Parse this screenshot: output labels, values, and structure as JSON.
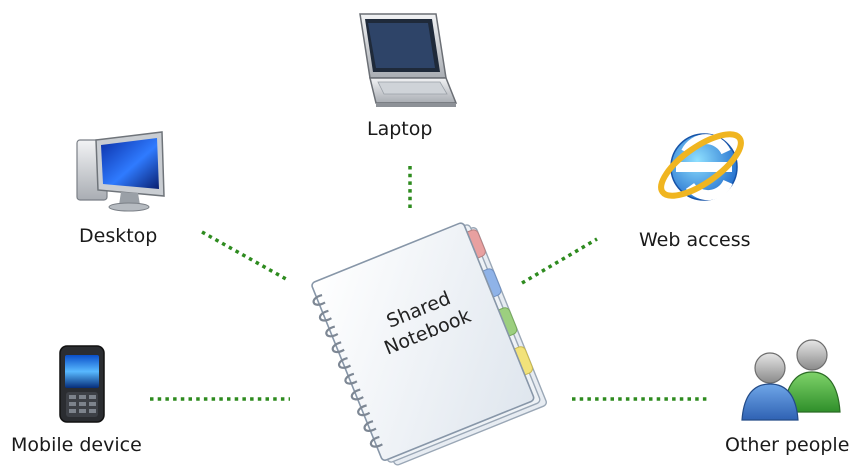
{
  "diagram": {
    "center": {
      "label_line1": "Shared",
      "label_line2": "Notebook"
    },
    "nodes": {
      "laptop": {
        "label": "Laptop",
        "icon": "laptop-icon"
      },
      "desktop": {
        "label": "Desktop",
        "icon": "desktop-monitor-icon"
      },
      "web": {
        "label": "Web access",
        "icon": "internet-explorer-icon"
      },
      "mobile": {
        "label": "Mobile device",
        "icon": "mobile-phone-icon"
      },
      "people": {
        "label": "Other people",
        "icon": "users-group-icon"
      }
    },
    "connector_color": "#2e8b1f",
    "tab_colors": [
      "#e8a0a0",
      "#8fb3e8",
      "#9ccf7f",
      "#f2e27a"
    ]
  }
}
